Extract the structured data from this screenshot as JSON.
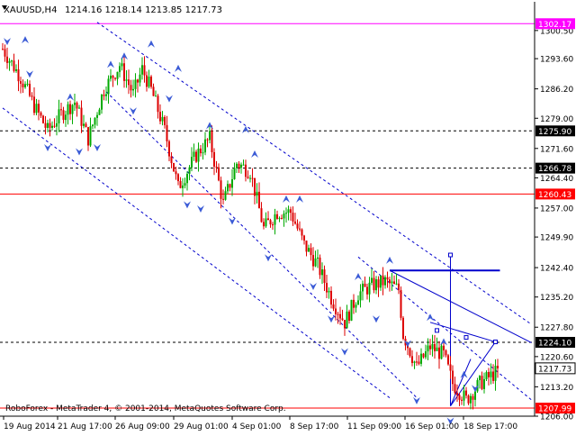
{
  "header": {
    "symbol": "XAUUSD,H4",
    "ohlc": "1214.16 1218.14 1213.85 1217.73"
  },
  "footer": {
    "copyright": "RoboForex - MetaTrader 4, © 2001-2014, MetaQuotes Software Corp."
  },
  "colors": {
    "bull": "#00aa00",
    "bear": "#dd0000",
    "line": "#0000cc",
    "marker": "#3b5bd6",
    "level_red": "#ff0000",
    "level_magenta": "#ff00ff",
    "axis_text": "#000000"
  },
  "chart_data": {
    "type": "candlestick",
    "symbol": "XAUUSD",
    "timeframe": "H4",
    "ylim": [
      1206.0,
      1304.0
    ],
    "y_ticks": [
      "1300.50",
      "1293.60",
      "1286.20",
      "1279.00",
      "1271.60",
      "1264.40",
      "1257.00",
      "1249.90",
      "1242.40",
      "1235.20",
      "1227.80",
      "1220.60",
      "1213.20",
      "1206.00"
    ],
    "x_ticks": [
      "19 Aug 2014",
      "21 Aug 17:00",
      "26 Aug 09:00",
      "29 Aug 01:00",
      "4 Sep 01:00",
      "8 Sep 17:00",
      "11 Sep 09:00",
      "16 Sep 01:00",
      "18 Sep 17:00"
    ],
    "current_price": {
      "value": 1217.73,
      "label": "1217.73"
    },
    "levels": [
      {
        "value": 1302.17,
        "label": "1302.17",
        "style": "solid",
        "color": "#ff00ff"
      },
      {
        "value": 1275.9,
        "label": "1275.90",
        "style": "dashed",
        "color": "#000000"
      },
      {
        "value": 1266.78,
        "label": "1266.78",
        "style": "dashed",
        "color": "#000000"
      },
      {
        "value": 1260.43,
        "label": "1260.43",
        "style": "solid",
        "color": "#ff0000"
      },
      {
        "value": 1224.1,
        "label": "1224.10",
        "style": "dashed",
        "color": "#000000"
      },
      {
        "value": 1207.99,
        "label": "1207.99",
        "style": "solid",
        "color": "#ff0000"
      }
    ],
    "anchors": [
      [
        0,
        1296
      ],
      [
        8,
        1289
      ],
      [
        14,
        1282
      ],
      [
        20,
        1276
      ],
      [
        26,
        1280
      ],
      [
        32,
        1283
      ],
      [
        38,
        1274
      ],
      [
        45,
        1286
      ],
      [
        52,
        1292
      ],
      [
        58,
        1285
      ],
      [
        62,
        1291
      ],
      [
        66,
        1286
      ],
      [
        72,
        1276
      ],
      [
        78,
        1262
      ],
      [
        86,
        1270
      ],
      [
        92,
        1274
      ],
      [
        98,
        1258
      ],
      [
        104,
        1268
      ],
      [
        110,
        1266
      ],
      [
        116,
        1252
      ],
      [
        122,
        1256
      ],
      [
        128,
        1256
      ],
      [
        134,
        1248
      ],
      [
        140,
        1243
      ],
      [
        146,
        1235
      ],
      [
        152,
        1229
      ],
      [
        158,
        1236
      ],
      [
        164,
        1238
      ],
      [
        170,
        1239
      ],
      [
        176,
        1237
      ],
      [
        178,
        1226
      ],
      [
        184,
        1218
      ],
      [
        190,
        1223
      ],
      [
        196,
        1221
      ],
      [
        200,
        1214
      ],
      [
        206,
        1210
      ],
      [
        212,
        1214
      ],
      [
        220,
        1217
      ]
    ],
    "candle_count": 221,
    "trendlines": [
      {
        "from": [
          0,
          1281.5
        ],
        "to": [
          172,
          1210.5
        ],
        "dash": true
      },
      {
        "from": [
          42,
          1302.5
        ],
        "to": [
          235,
          1228.5
        ],
        "dash": true
      },
      {
        "from": [
          46,
          1285.5
        ],
        "to": [
          185,
          1210.0
        ],
        "dash": true
      },
      {
        "from": [
          158,
          1245.0
        ],
        "to": [
          235,
          1210.0
        ],
        "dash": true
      },
      {
        "from": [
          172,
          1241.7
        ],
        "to": [
          235,
          1224.0
        ],
        "dash": false
      },
      {
        "from": [
          190,
          1229.0
        ],
        "to": [
          219,
          1224.2
        ],
        "dash": false
      },
      {
        "from": [
          199,
          1208.5
        ],
        "to": [
          219,
          1224.2
        ],
        "dash": false
      },
      {
        "from": [
          199,
          1208.5
        ],
        "to": [
          208,
          1220.0
        ],
        "dash": false
      }
    ],
    "boxes": [
      {
        "x": [
          172,
          221
        ],
        "y": [
          1241.7,
          1241.7
        ]
      }
    ],
    "vertical_marker": {
      "x": 199,
      "y": [
        1208.5,
        1245.5
      ]
    },
    "small_markers": [
      [
        193,
        1227.0
      ],
      [
        206,
        1225.3
      ],
      [
        219,
        1224.2
      ]
    ],
    "fractal_markers": [
      [
        2,
        1298,
        "down"
      ],
      [
        10,
        1298,
        "up"
      ],
      [
        12,
        1290,
        "down"
      ],
      [
        20,
        1272,
        "down"
      ],
      [
        30,
        1284,
        "up"
      ],
      [
        34,
        1271,
        "down"
      ],
      [
        42,
        1272,
        "down"
      ],
      [
        48,
        1292,
        "up"
      ],
      [
        54,
        1294,
        "up"
      ],
      [
        58,
        1281,
        "down"
      ],
      [
        66,
        1297,
        "up"
      ],
      [
        74,
        1284,
        "down"
      ],
      [
        78,
        1291,
        "up"
      ],
      [
        82,
        1258,
        "down"
      ],
      [
        88,
        1257,
        "down"
      ],
      [
        92,
        1277,
        "up"
      ],
      [
        102,
        1254,
        "down"
      ],
      [
        108,
        1276,
        "up"
      ],
      [
        112,
        1270,
        "up"
      ],
      [
        118,
        1245,
        "down"
      ],
      [
        126,
        1259,
        "up"
      ],
      [
        132,
        1259,
        "up"
      ],
      [
        138,
        1238,
        "down"
      ],
      [
        146,
        1230,
        "down"
      ],
      [
        152,
        1222,
        "down"
      ],
      [
        158,
        1240,
        "up"
      ],
      [
        166,
        1230,
        "down"
      ],
      [
        172,
        1244,
        "up"
      ],
      [
        180,
        1224,
        "down"
      ],
      [
        184,
        1210,
        "down"
      ],
      [
        190,
        1230,
        "up"
      ],
      [
        196,
        1224,
        "up"
      ],
      [
        199,
        1205,
        "down"
      ],
      [
        205,
        1216,
        "up"
      ],
      [
        210,
        1213,
        "down"
      ]
    ]
  }
}
